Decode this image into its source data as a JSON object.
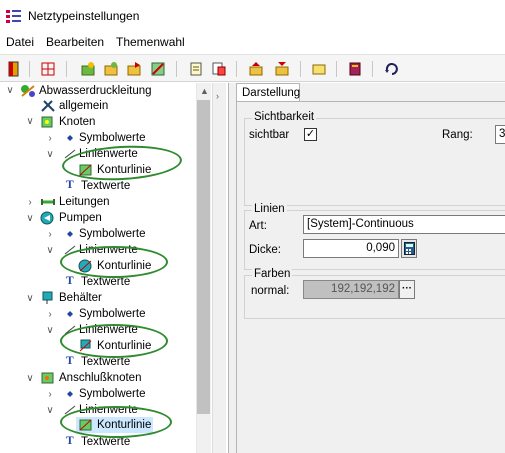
{
  "window": {
    "title": "Netztypeinstellungen"
  },
  "menu": {
    "items": [
      "Datei",
      "Bearbeiten",
      "Themenwahl"
    ]
  },
  "toolbar": {
    "buttons": [
      "exit-icon",
      "grid-icon",
      "add-green-icon",
      "add-yellow-icon",
      "open-folder-icon",
      "edit-icon",
      "copy-page-icon",
      "paste-page-icon",
      "import-icon",
      "export-icon",
      "folder-icon",
      "book-icon",
      "refresh-icon"
    ]
  },
  "tree": {
    "root": "Abwasserdruckleitung",
    "allgemein": "allgemein",
    "knoten": "Knoten",
    "symbolwerte": "Symbolwerte",
    "linienwerte": "Linienwerte",
    "konturlinie": "Konturlinie",
    "textwerte": "Textwerte",
    "leitungen": "Leitungen",
    "pumpen": "Pumpen",
    "behaelter": "Behälter",
    "anschlussknoten": "Anschlußknoten"
  },
  "tabs": [
    "Darstellung"
  ],
  "panel": {
    "sichtbarkeit": {
      "title": "Sichtbarkeit",
      "sichtbar_label": "sichtbar",
      "sichtbar_checked": true,
      "rang_label": "Rang:",
      "rang_value": "3"
    },
    "linien": {
      "title": "Linien",
      "art_label": "Art:",
      "art_value": "[System]-Continuous",
      "dicke_label": "Dicke:",
      "dicke_value": "0,090"
    },
    "farben": {
      "title": "Farben",
      "normal_label": "normal:",
      "normal_value": "192,192,192",
      "ellipsis": "···"
    }
  },
  "colors": {
    "highlight_ellipse": "#2e8b2e",
    "selection": "#cce8ff"
  }
}
